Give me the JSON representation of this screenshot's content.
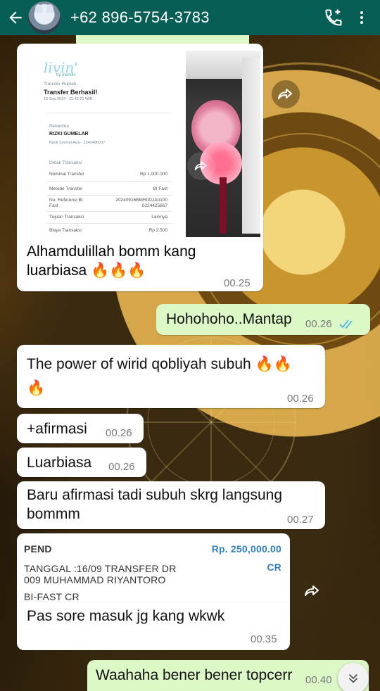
{
  "header": {
    "title": "+62 896-5754-3783"
  },
  "messages": {
    "m1": {
      "text": "Alhamdulillah bomm kang luarbiasa 🔥🔥🔥",
      "line1": "Alhamdulillah bomm kang",
      "line2": "luarbiasa",
      "time": "00.25"
    },
    "m2": {
      "text": "Hohohoho..Mantap",
      "time": "00.26"
    },
    "m3": {
      "line1": "The power of wirid qobliyah subuh",
      "time": "00.26"
    },
    "m4": {
      "text": "+afirmasi",
      "time": "00.26"
    },
    "m5": {
      "text": "Luarbiasa",
      "time": "00.26"
    },
    "m6": {
      "line1": "Baru afirmasi tadi subuh skrg langsung",
      "line2": "bommm",
      "time": "00.27"
    },
    "m7": {
      "text": "Pas sore masuk jg kang wkwk",
      "time": "00.35"
    },
    "m8": {
      "text": "Waahaha bener bener topcerr",
      "time": "00.40"
    }
  },
  "receipt": {
    "logo": "livin'",
    "logo_sub": "by mandiri",
    "category": "Transfer Rupiah",
    "status": "Transfer Berhasil!",
    "datetime": "16 Sep 2024 - 21:42:21 WIB",
    "recipient_label": "Penerima",
    "recipient_name": "RIZKI GUMELAR",
    "recipient_bank": "Bank Central Asia - 1342496037",
    "detail_label": "Detail Transaksi",
    "rows": [
      {
        "label": "Nominal Transfer",
        "value": "Rp 1.000.000"
      },
      {
        "label": "Metode Transfer",
        "value": "BI Fast"
      },
      {
        "label": "No. Referensi BI Fast",
        "value": "20240916BMRIIDJA0100 0224425667"
      },
      {
        "label": "Tujuan Transaksi",
        "value": "Lainnya"
      },
      {
        "label": "Biaya Transaksi",
        "value": "Rp 2.500"
      }
    ]
  },
  "bank_notice": {
    "status": "PEND",
    "amount": "Rp. 250,000.00",
    "line1": "TANGGAL :16/09   TRANSFER   DR",
    "cr": "CR",
    "line2": "009 MUHAMMAD RIYANTORO",
    "line3": "BI-FAST CR"
  },
  "icons": {
    "back": "arrow-left-icon",
    "call": "add-call-icon",
    "menu": "more-vert-icon",
    "forward": "forward-icon",
    "read": "double-check-icon",
    "scroll": "chevron-double-down-icon",
    "fire": "fire-emoji"
  },
  "colors": {
    "header": "#075e54",
    "outgoing": "#dcf8c6",
    "incoming": "#ffffff",
    "read_tick": "#4fb6ec",
    "amount_blue": "#2f7fc1"
  }
}
